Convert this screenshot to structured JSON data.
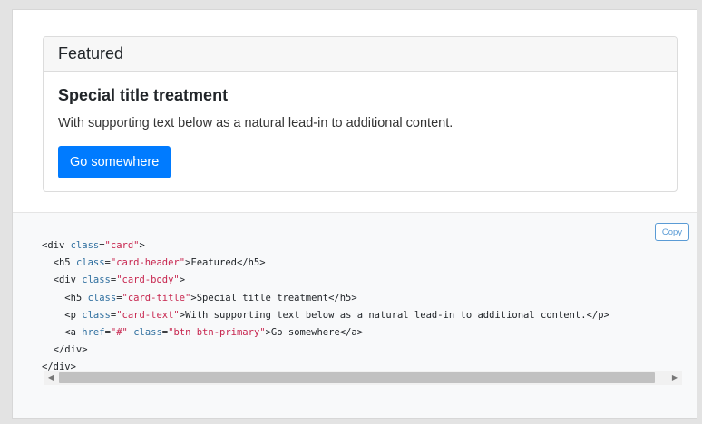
{
  "card": {
    "header": "Featured",
    "title": "Special title treatment",
    "text": "With supporting text below as a natural lead-in to additional content.",
    "button_label": "Go somewhere"
  },
  "code_block": {
    "copy_label": "Copy",
    "lines": [
      "<div class=\"card\">",
      "  <h5 class=\"card-header\">Featured</h5>",
      "  <div class=\"card-body\">",
      "    <h5 class=\"card-title\">Special title treatment</h5>",
      "    <p class=\"card-text\">With supporting text below as a natural lead-in to additional content.</p>",
      "    <a href=\"#\" class=\"btn btn-primary\">Go somewhere</a>",
      "  </div>",
      "</div>"
    ]
  },
  "icons": {
    "scroll_left": "triangle-left",
    "scroll_right": "triangle-right"
  },
  "colors": {
    "primary_button": "#007bff",
    "copy_button": "#5a9bd5",
    "code_attr_value": "#c7254e",
    "code_attr_name": "#2f6f9f"
  }
}
